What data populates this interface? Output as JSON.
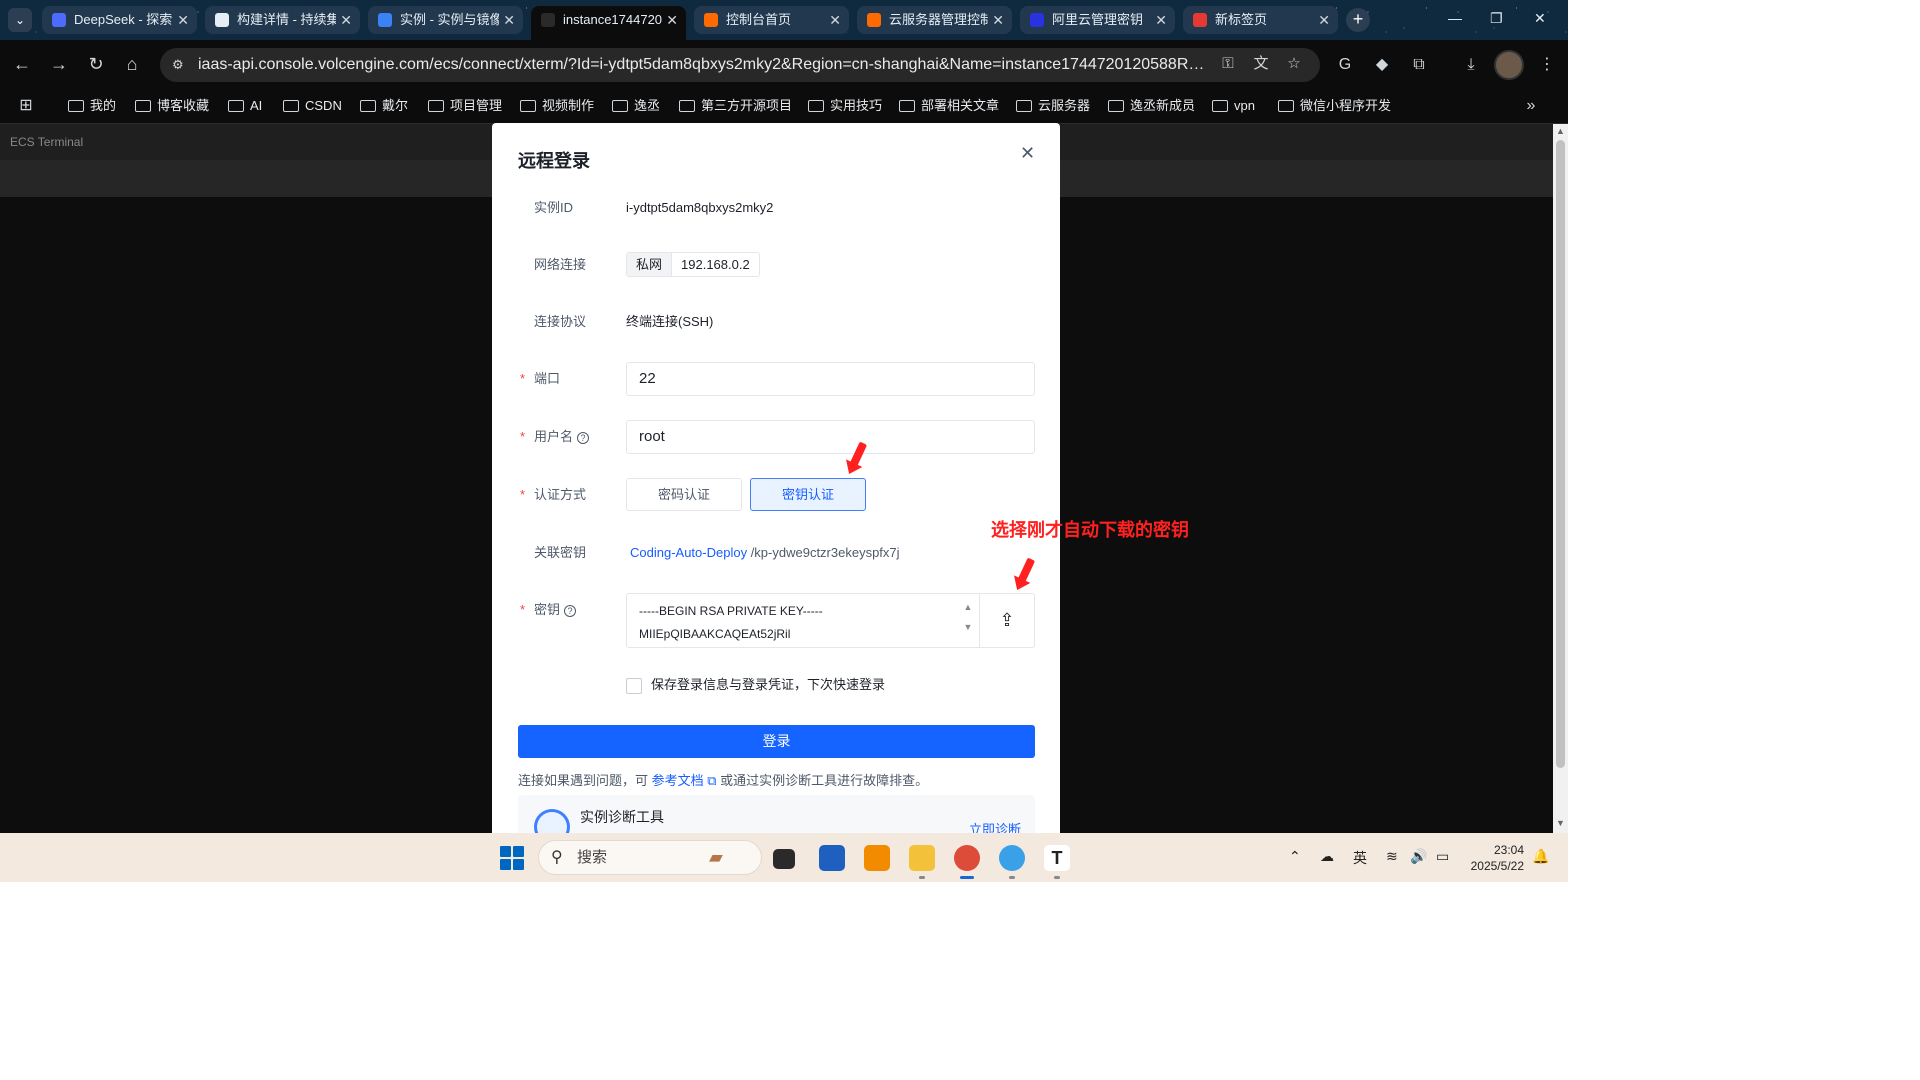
{
  "browser": {
    "tabs": [
      {
        "title": "DeepSeek - 探索",
        "color": "#4d6bfe",
        "active": false
      },
      {
        "title": "构建详情 - 持续集",
        "color": "#e6eef5",
        "active": false
      },
      {
        "title": "实例 - 实例与镜像",
        "color": "#3b82f6",
        "active": false
      },
      {
        "title": "instance1744720",
        "color": "#2a2a2a",
        "active": true
      },
      {
        "title": "控制台首页",
        "color": "#ff6a00",
        "active": false
      },
      {
        "title": "云服务器管理控制台",
        "color": "#ff6a00",
        "active": false
      },
      {
        "title": "阿里云管理密钥",
        "color": "#2932e1",
        "active": false
      },
      {
        "title": "新标签页",
        "color": "#e53935",
        "active": false
      }
    ],
    "url": "iaas-api.console.volcengine.com/ecs/connect/xterm/?Id=i-ydtpt5dam8qbxys2mky2&Region=cn-shanghai&Name=instance1744720120588R889...",
    "bookmarks": [
      "我的",
      "博客收藏",
      "AI",
      "CSDN",
      "戴尔",
      "项目管理",
      "视频制作",
      "逸丞",
      "第三方开源项目",
      "实用技巧",
      "部署相关文章",
      "云服务器",
      "逸丞新成员",
      "vpn",
      "微信小程序开发"
    ]
  },
  "page": {
    "header_title": "ECS Terminal"
  },
  "modal": {
    "title": "远程登录",
    "close_symbol": "✕",
    "instance_id_label": "实例ID",
    "instance_id": "i-ydtpt5dam8qbxys2mky2",
    "network_label": "网络连接",
    "network_type": "私网",
    "network_ip": "192.168.0.2",
    "protocol_label": "连接协议",
    "protocol": "终端连接(SSH)",
    "port_label": "端口",
    "port": "22",
    "username_label": "用户名",
    "username": "root",
    "auth_label": "认证方式",
    "auth_password": "密码认证",
    "auth_key": "密钥认证",
    "related_key_label": "关联密钥",
    "related_key_name": "Coding-Auto-Deploy",
    "related_key_suffix": " /kp-ydwe9ctzr3ekeyspfx7j",
    "key_label": "密钥",
    "key_content": "-----BEGIN RSA PRIVATE KEY-----\nMIIEpQIBAAKCAQEAt52jRil",
    "save_label": "保存登录信息与登录凭证，下次快速登录",
    "login_button": "登录",
    "hint_prefix": "连接如果遇到问题，可 ",
    "hint_link": "参考文档",
    "hint_suffix": " 或通过实例诊断工具进行故障排查。",
    "diag_title": "实例诊断工具",
    "diag_action": "立即诊断"
  },
  "annotation": {
    "text": "选择刚才自动下载的密钥"
  },
  "taskbar": {
    "search_placeholder": "搜索",
    "ime": "英",
    "time": "23:04",
    "date": "2025/5/22"
  }
}
